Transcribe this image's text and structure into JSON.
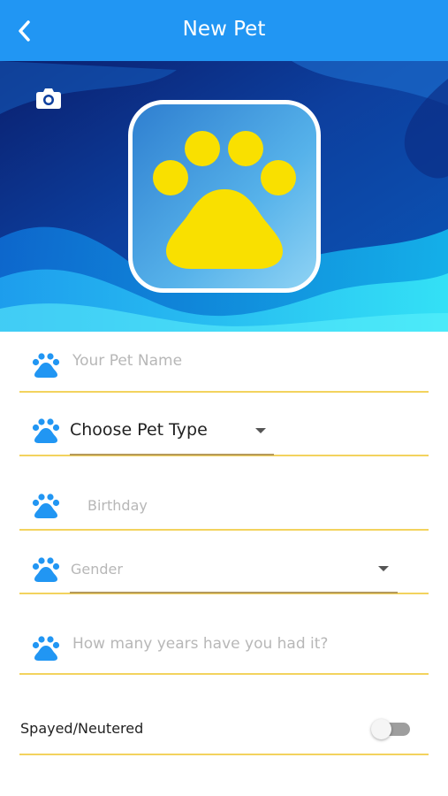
{
  "header": {
    "title": "New Pet",
    "back_icon": "chevron-left-icon",
    "background_color": "#2196f3"
  },
  "hero": {
    "camera_icon": "camera-icon",
    "logo_icon": "paw-logo-icon",
    "paw_color": "#f9e000"
  },
  "form": {
    "pet_name": {
      "placeholder": "Your Pet Name",
      "value": ""
    },
    "pet_type": {
      "label": "Choose Pet Type"
    },
    "birthday": {
      "placeholder": "Birthday"
    },
    "gender": {
      "placeholder": "Gender"
    },
    "years_owned": {
      "placeholder": "How many years have you had it?",
      "value": ""
    },
    "spayed": {
      "label": "Spayed/Neutered",
      "on": false
    }
  },
  "colors": {
    "accent_underline": "#f3d35e",
    "paw_icon": "#2196f3"
  }
}
